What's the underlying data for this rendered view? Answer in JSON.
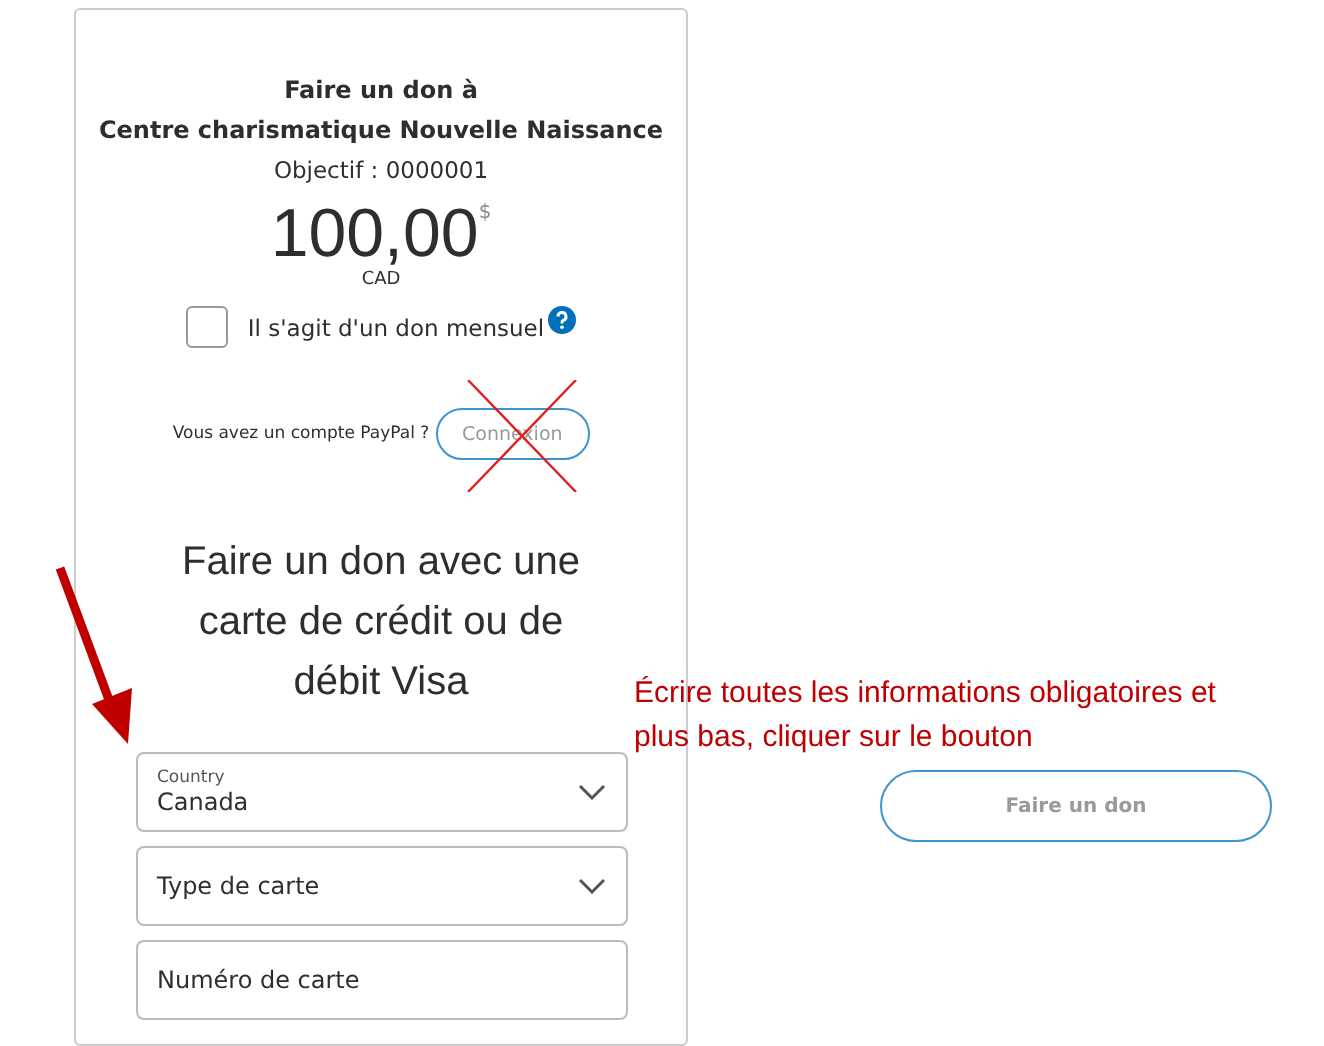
{
  "header": {
    "title": "Faire un don à",
    "recipient": "Centre charismatique Nouvelle Naissance",
    "goal": "Objectif : 0000001"
  },
  "amount": {
    "value": "100,00",
    "currency_symbol": "$",
    "currency": "CAD"
  },
  "monthly": {
    "label": "Il s'agit d'un don mensuel",
    "checked": false
  },
  "login": {
    "prompt": "Vous avez un compte PayPal ?",
    "button": "Connexion",
    "crossed_out": true
  },
  "card_heading": "Faire un don avec une carte de crédit ou de débit Visa",
  "fields": [
    {
      "kind": "select",
      "label": "Country",
      "value": "Canada"
    },
    {
      "kind": "select",
      "placeholder": "Type de carte"
    },
    {
      "kind": "text",
      "placeholder": "Numéro de carte"
    }
  ],
  "annotation": {
    "text": "Écrire toutes les informations obligatoires et plus bas, cliquer sur le bouton",
    "button": "Faire un don"
  }
}
